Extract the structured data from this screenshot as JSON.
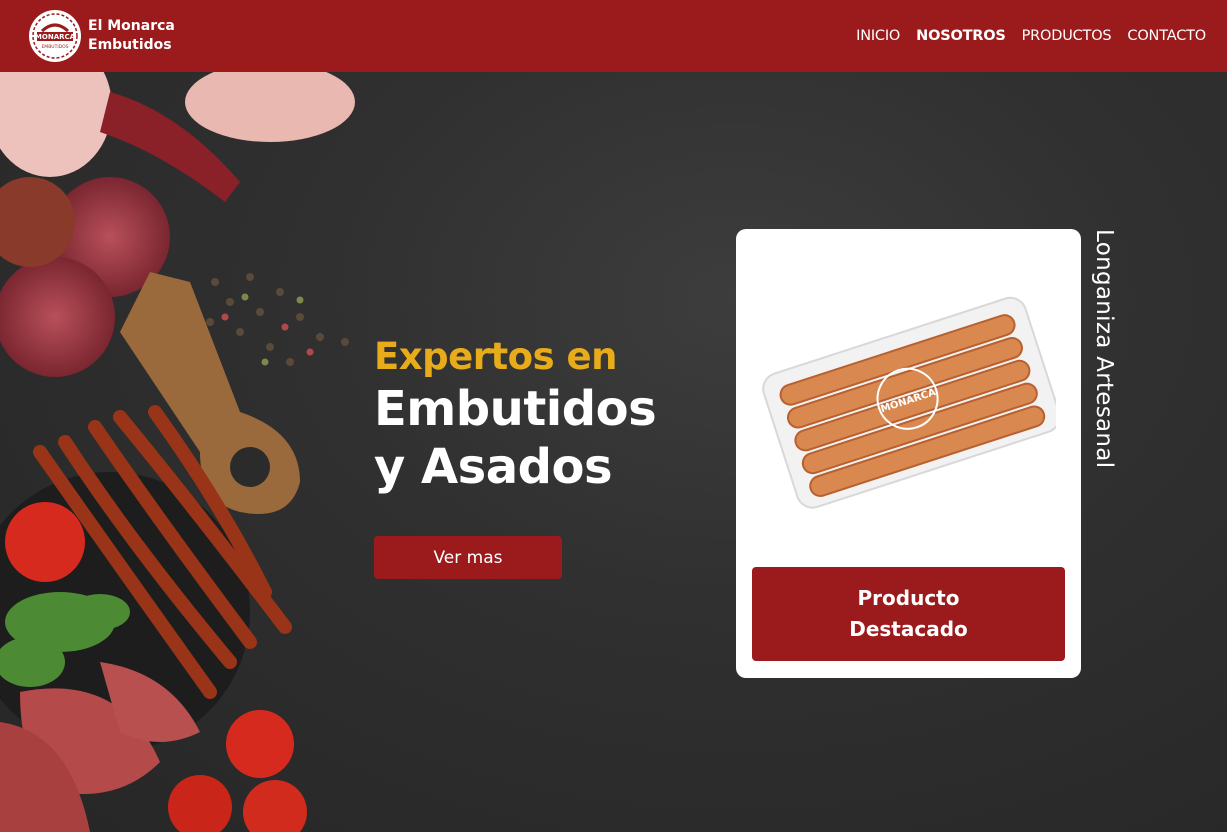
{
  "brand": {
    "logo_text": "MONARCA",
    "logo_subtext": "EMBUTIDOS",
    "name_line1": "El Monarca",
    "name_line2": "Embutidos"
  },
  "nav": {
    "items": [
      {
        "label": "INICIO",
        "active": false
      },
      {
        "label": "NOSOTROS",
        "active": true
      },
      {
        "label": "PRODUCTOS",
        "active": false
      },
      {
        "label": "CONTACTO",
        "active": false
      }
    ]
  },
  "hero": {
    "headline_top": "Expertos en",
    "headline_main": "Embutidos\ny Asados",
    "cta_label": "Ver mas"
  },
  "featured": {
    "button_label": "Producto\nDestacado",
    "product_name": "Longaniza Artesanal",
    "package_logo_text": "MONARCA"
  },
  "colors": {
    "brand_red": "#9b1b1c",
    "accent_gold": "#e8ac1b",
    "background_dark": "#2b2b2b"
  }
}
